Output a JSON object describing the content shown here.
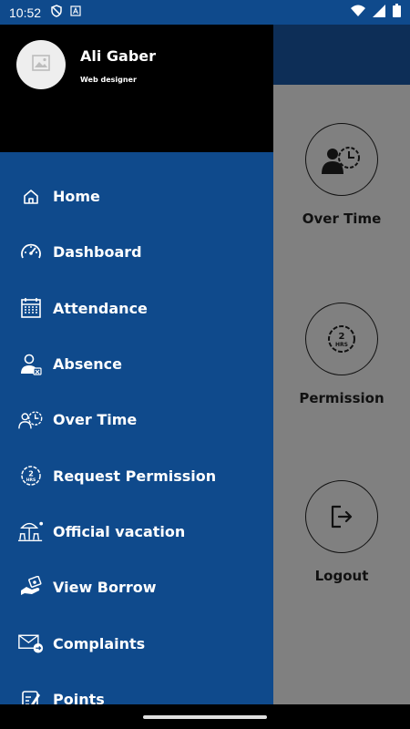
{
  "status_bar": {
    "time": "10:52",
    "icons": [
      "shield-icon",
      "a-icon"
    ],
    "right_icons": [
      "wifi-icon",
      "signal-icon",
      "battery-icon"
    ]
  },
  "profile": {
    "name": "Ali Gaber",
    "role": "Web designer",
    "avatar_icon": "image-placeholder-icon"
  },
  "menu": {
    "items": [
      {
        "label": "Home",
        "icon": "home-icon"
      },
      {
        "label": "Dashboard",
        "icon": "dashboard-icon"
      },
      {
        "label": "Attendance",
        "icon": "calendar-icon"
      },
      {
        "label": "Absence",
        "icon": "absence-icon"
      },
      {
        "label": "Over Time",
        "icon": "overtime-icon"
      },
      {
        "label": "Request Permission",
        "icon": "permission-icon"
      },
      {
        "label": "Official vacation",
        "icon": "vacation-icon"
      },
      {
        "label": "View Borrow",
        "icon": "borrow-icon"
      },
      {
        "label": "Complaints",
        "icon": "complaints-icon"
      },
      {
        "label": "Points",
        "icon": "points-icon"
      }
    ]
  },
  "background_grid": {
    "overtime_label": "Over Time",
    "permission_label": "Permission",
    "permission_icon_text": "2\nHRS",
    "logout_label": "Logout"
  },
  "colors": {
    "drawer": "#0f4a8c",
    "header": "#000000",
    "scrim": "#808080",
    "app_bar": "#0d2e57"
  }
}
